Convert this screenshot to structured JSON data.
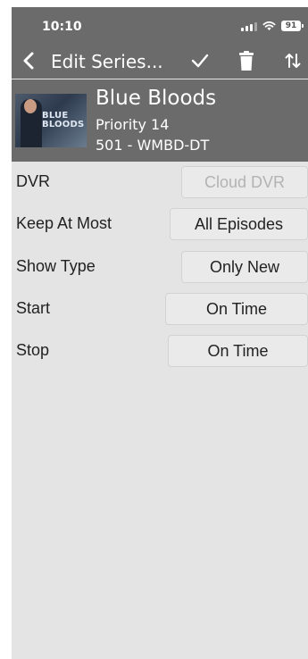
{
  "status_bar": {
    "time": "10:10",
    "battery": "91",
    "signal_icon": "signal-icon",
    "wifi_icon": "wifi-icon"
  },
  "nav_bar": {
    "back_icon": "chevron-left-icon",
    "title": "Edit Series...",
    "actions": [
      "check-icon",
      "trash-icon",
      "sort-icon"
    ]
  },
  "show": {
    "title": "Blue Bloods",
    "priority": "Priority 14",
    "channel": "501 - WMBD-DT",
    "poster_logo_line1": "BLUE",
    "poster_logo_line2": "BLOODS"
  },
  "settings": [
    {
      "label": "DVR",
      "value": "Cloud DVR",
      "disabled": true
    },
    {
      "label": "Keep At Most",
      "value": "All Episodes",
      "disabled": false
    },
    {
      "label": "Show Type",
      "value": "Only New",
      "disabled": false
    },
    {
      "label": "Start",
      "value": "On Time",
      "disabled": false
    },
    {
      "label": "Stop",
      "value": "On Time",
      "disabled": false
    }
  ],
  "colors": {
    "header_bg": "#6b6b6b",
    "page_bg": "#e4e4e4",
    "button_bg": "#eaeaea",
    "disabled_text": "#b3b3b3"
  }
}
